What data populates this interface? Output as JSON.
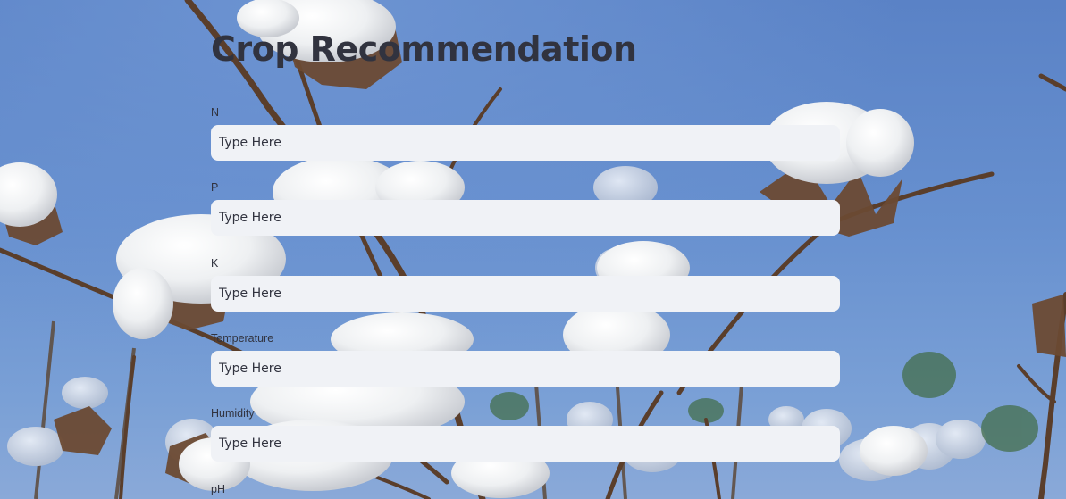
{
  "app": {
    "title": "Crop Recommendation"
  },
  "form": {
    "fields": [
      {
        "label": "N",
        "placeholder": "Type Here"
      },
      {
        "label": "P",
        "placeholder": "Type Here"
      },
      {
        "label": "K",
        "placeholder": "Type Here"
      },
      {
        "label": "Temperature",
        "placeholder": "Type Here"
      },
      {
        "label": "Humidity",
        "placeholder": "Type Here"
      },
      {
        "label": "pH",
        "placeholder": ""
      }
    ]
  },
  "colors": {
    "sky": "#5f87c8",
    "text": "#31333f",
    "input_background": "#f0f2f6"
  }
}
